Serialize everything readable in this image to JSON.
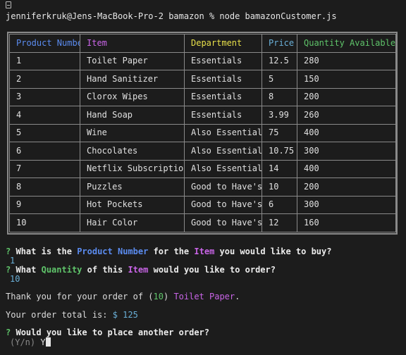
{
  "terminal": {
    "prompt": "jenniferkruk@Jens-MacBook-Pro-2 bamazon % node bamazonCustomer.js"
  },
  "table": {
    "headers": [
      "Product Number",
      "Item",
      "Department",
      "Price",
      "Quantity Available"
    ],
    "rows": [
      [
        "1",
        "Toilet Paper",
        "Essentials",
        "12.5",
        "280"
      ],
      [
        "2",
        "Hand Sanitizer",
        "Essentials",
        "5",
        "150"
      ],
      [
        "3",
        "Clorox Wipes",
        "Essentials",
        "8",
        "200"
      ],
      [
        "4",
        "Hand Soap",
        "Essentials",
        "3.99",
        "260"
      ],
      [
        "5",
        "Wine",
        "Also Essential",
        "75",
        "400"
      ],
      [
        "6",
        "Chocolates",
        "Also Essential",
        "10.75",
        "300"
      ],
      [
        "7",
        "Netflix Subscription",
        "Also Essential",
        "14",
        "400"
      ],
      [
        "8",
        "Puzzles",
        "Good to Have's",
        "10",
        "200"
      ],
      [
        "9",
        "Hot Pockets",
        "Good to Have's",
        "6",
        "300"
      ],
      [
        "10",
        "Hair Color",
        "Good to Have's",
        "12",
        "160"
      ]
    ]
  },
  "q1": {
    "mark": "?",
    "t1": "What is the",
    "k1": "Product Number",
    "t2": "for the",
    "k2": "Item",
    "t3": "you would like to buy?",
    "answer": "1"
  },
  "q2": {
    "mark": "?",
    "t1": "What",
    "k1": "Quantity",
    "t2": "of this",
    "k2": "Item",
    "t3": "would you like to order?",
    "answer": "10"
  },
  "thanks": {
    "prefix": "Thank you for your order of (",
    "qty": "10",
    "mid": ")",
    "item": "Toilet Paper",
    "suffix": "."
  },
  "total": {
    "label": "Your order total is:",
    "value": "$ 125"
  },
  "q3": {
    "mark": "?",
    "text": "Would you like to place another order?",
    "hint": "(Y/n)",
    "answer": "Y"
  },
  "colors": {
    "background": "#1c1c1c",
    "blue": "#5b8cf0",
    "pink": "#c864e6",
    "yellow": "#e8e04a",
    "cyan": "#6ab0d8",
    "green": "#5fc46a"
  }
}
